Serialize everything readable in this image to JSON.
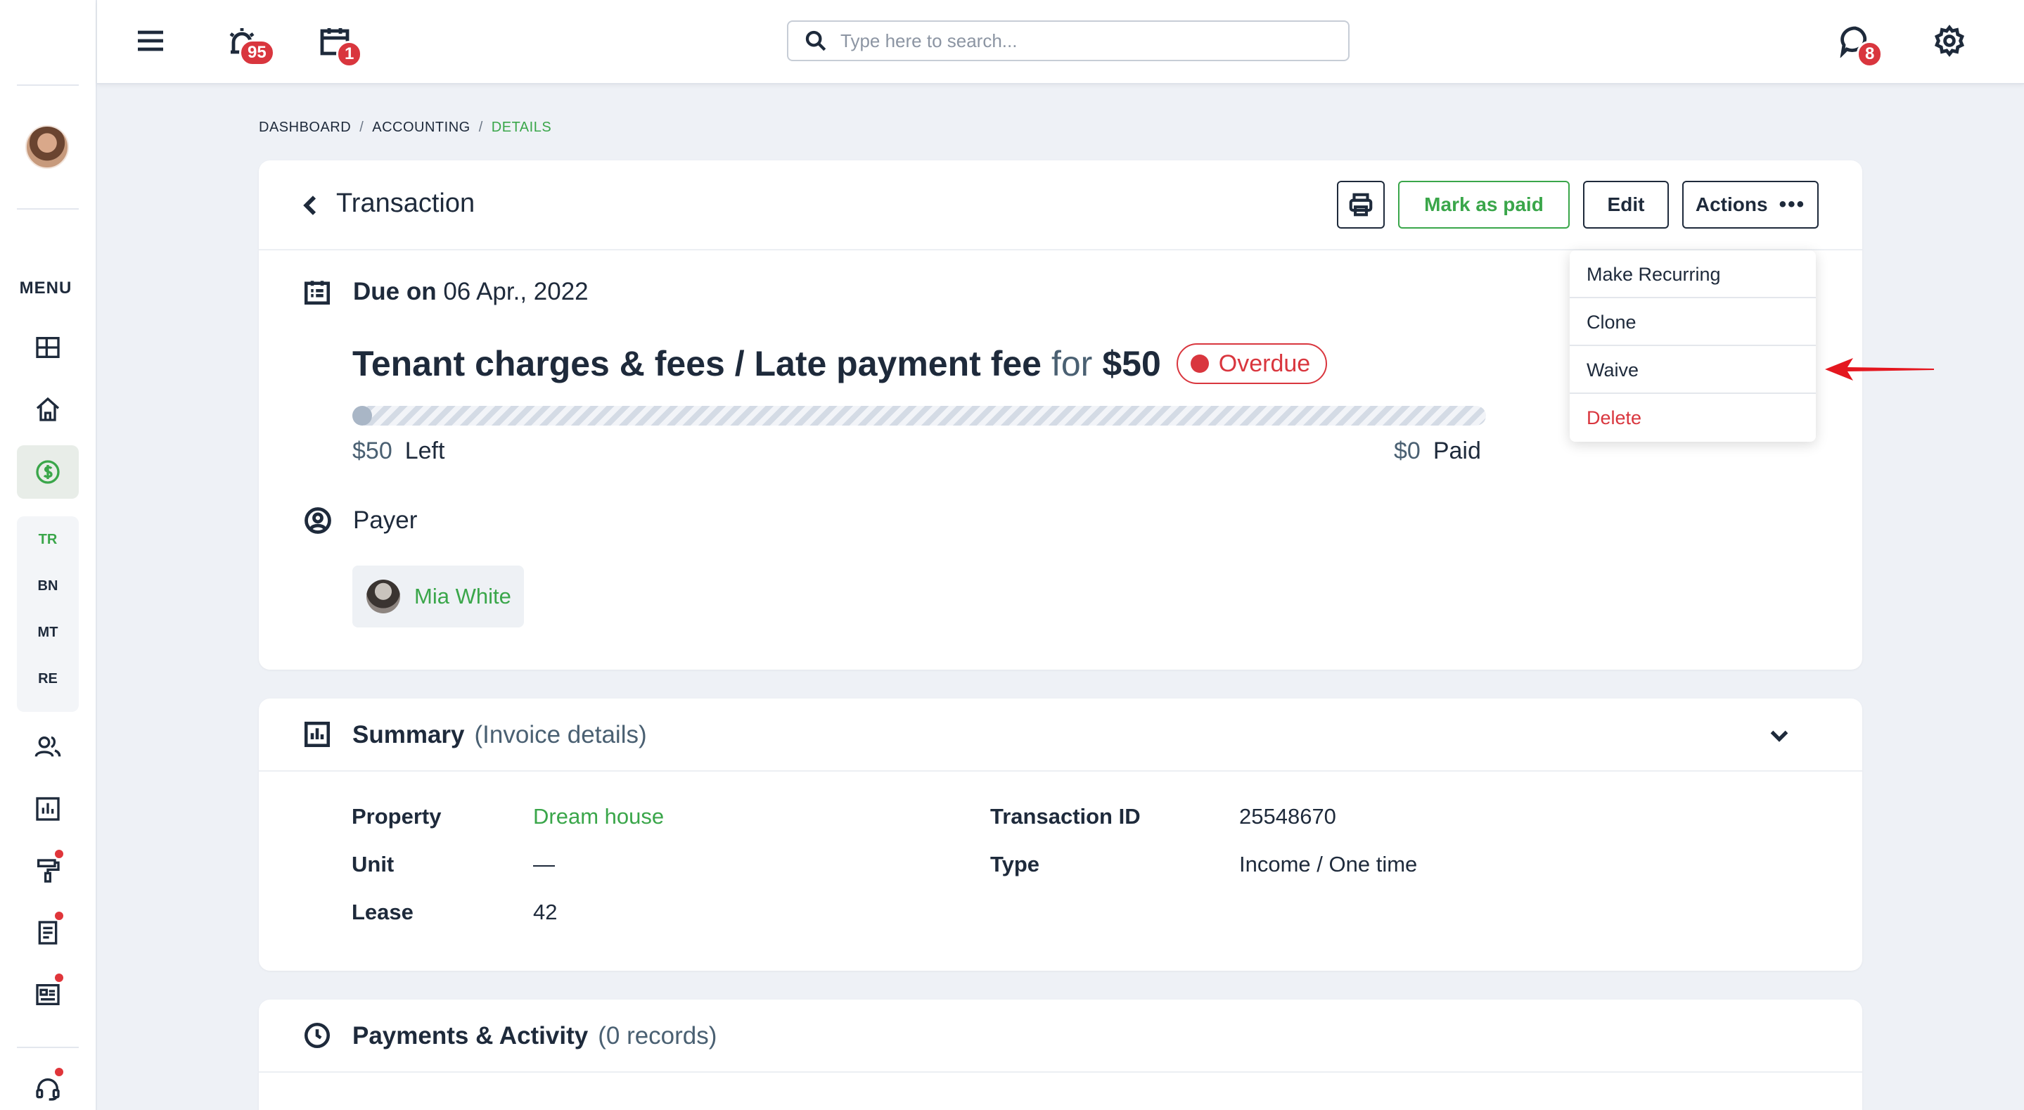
{
  "topbar": {
    "alarm_badge": "95",
    "calendar_badge": "1",
    "search_placeholder": "Type here to search...",
    "chat_badge": "8"
  },
  "sidebar": {
    "menu_label": "MENU",
    "subnav": [
      "TR",
      "BN",
      "MT",
      "RE"
    ]
  },
  "breadcrumb": {
    "items": [
      "DASHBOARD",
      "ACCOUNTING",
      "DETAILS"
    ],
    "separator": "/"
  },
  "header": {
    "title": "Transaction",
    "mark_paid_label": "Mark as paid",
    "edit_label": "Edit",
    "actions_label": "Actions",
    "actions_dots": "•••"
  },
  "actions_menu": {
    "items": [
      "Make Recurring",
      "Clone",
      "Waive",
      "Delete"
    ]
  },
  "transaction": {
    "due_label": "Due on",
    "due_date": "06 Apr., 2022",
    "category": "Tenant charges & fees / Late payment fee",
    "for_word": "for",
    "amount": "$50",
    "status": "Overdue",
    "paid_fraction": 0,
    "left_amount": "$50",
    "left_label": "Left",
    "paid_amount": "$0",
    "paid_label": "Paid",
    "payer_label": "Payer",
    "payer_name": "Mia White"
  },
  "summary": {
    "title": "Summary",
    "subtitle": "(Invoice details)",
    "property_label": "Property",
    "property_value": "Dream house",
    "unit_label": "Unit",
    "unit_value": "—",
    "lease_label": "Lease",
    "lease_value": "42",
    "transaction_id_label": "Transaction ID",
    "transaction_id_value": "25548670",
    "type_label": "Type",
    "type_value": "Income / One time"
  },
  "payments": {
    "title": "Payments & Activity",
    "subtitle": "(0 records)"
  },
  "colors": {
    "accent_green": "#3aa64a",
    "danger_red": "#d9363e",
    "text_dark": "#1e2a3b",
    "page_bg": "#eef1f6"
  }
}
